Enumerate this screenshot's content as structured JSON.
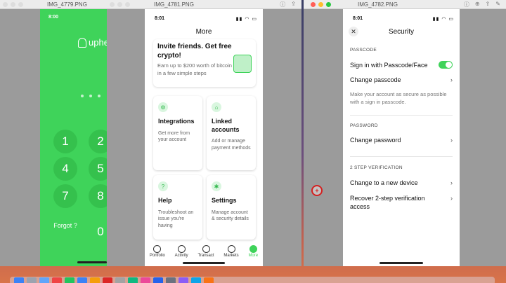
{
  "windows": {
    "a": {
      "title": "IMG_4779.PNG"
    },
    "b": {
      "title": "IMG_4781.PNG"
    },
    "c": {
      "title": "IMG_4782.PNG"
    }
  },
  "uphold": {
    "time": "8:00",
    "logo_text": "uphe",
    "keys": [
      "1",
      "2",
      "4",
      "5",
      "7",
      "8",
      "0"
    ],
    "forgot": "Forgot ?"
  },
  "more": {
    "time": "8:01",
    "title": "More",
    "invite": {
      "title": "Invite friends. Get free crypto!",
      "subtitle": "Earn up to $200 worth of bitcoin in a few simple steps"
    },
    "cards": [
      {
        "title": "Integrations",
        "subtitle": "Get more from your account"
      },
      {
        "title": "Linked accounts",
        "subtitle": "Add or manage payment methods"
      },
      {
        "title": "Help",
        "subtitle": "Troubleshoot an issue you're having"
      },
      {
        "title": "Settings",
        "subtitle": "Manage account & security details"
      }
    ],
    "tabs": [
      "Portfolio",
      "Activity",
      "Transact",
      "Markets",
      "More"
    ]
  },
  "security": {
    "time": "8:01",
    "title": "Security",
    "passcode_label": "PASSCODE",
    "sign_in_passcode": "Sign in with Passcode/Face",
    "sign_in_passcode_enabled": true,
    "change_passcode": "Change passcode",
    "passcode_desc": "Make your account as secure as possible with a sign in passcode.",
    "password_label": "PASSWORD",
    "change_password": "Change password",
    "twostep_label": "2 STEP VERIFICATION",
    "change_device": "Change to a new device",
    "recover_access": "Recover 2-step verification access"
  },
  "colors": {
    "brand_green": "#3fd35a",
    "close_red": "#ff5f57",
    "minimize_yellow": "#febc2e",
    "zoom_green": "#28c840"
  }
}
